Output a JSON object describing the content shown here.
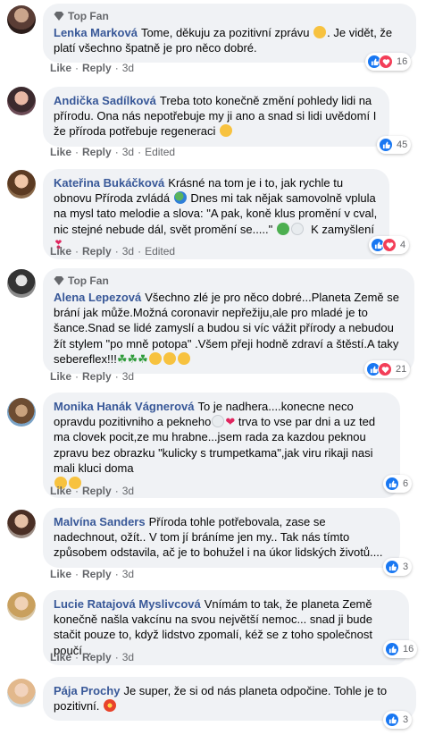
{
  "colors": {
    "author_link": "#385898",
    "meta_text": "#65676b",
    "bubble_bg": "#f0f2f5",
    "like": "#1877f2",
    "love": "#f33e58"
  },
  "actions": {
    "like": "Like",
    "reply": "Reply",
    "edited": "Edited"
  },
  "badges": {
    "top_fan": "Top Fan"
  },
  "comments": [
    {
      "author": "Lenka Marková",
      "top_fan": true,
      "text": "Tome, děkuju za pozitivní zprávu",
      "text2": ". Je vidět, že platí všechno špatně je pro něco dobré.",
      "time": "3d",
      "reactions": [
        "like",
        "love"
      ],
      "count": "16"
    },
    {
      "author": "Andička Sadílková",
      "top_fan": false,
      "text": "Treba toto konečně změní pohledy lidi na přírodu. Ona nás nepotřebuje my ji ano a snad si lidi uvědomí I že příroda potřebuje regeneraci",
      "time": "3d",
      "edited": true,
      "reactions": [
        "like"
      ],
      "count": "45"
    },
    {
      "author": "Kateřina Bukáčková",
      "top_fan": false,
      "text": "Krásné na tom je i to, jak rychle tu obnovu Příroda zvládá",
      "text2": "Dnes mi tak nějak samovolně vplula na mysl tato melodie a slova: \"A pak, koně klus promění v cval,",
      "text3": "nic stejné nebude dál, svět promění se.....\"",
      "text4": "K zamyšlení",
      "time": "3d",
      "edited": true,
      "reactions": [
        "like",
        "love"
      ],
      "count": "4"
    },
    {
      "author": "Alena Lepezová",
      "top_fan": true,
      "text": "Všechno zlé je pro něco dobré...Planeta Země se brání jak může.Možná coronavir nepřežiju,ale pro mladé je to šance.Snad se lidé zamyslí a budou si víc vážit přírody a nebudou žít stylem \"po mně potopa\" .Všem přeji hodně zdraví a štěstí.A taky sebereflex!!!",
      "time": "3d",
      "reactions": [
        "like",
        "love"
      ],
      "count": "21"
    },
    {
      "author": "Monika Hanák Vágnerová",
      "top_fan": false,
      "text": "To je nadhera....konecne neco opravdu pozitivniho a pekneho",
      "text2": "trva to vse par dni a uz ted ma clovek pocit,ze mu hrabne...jsem rada za kazdou peknou zpravu bez obrazku \"kulicky s trumpetkama\",jak viru rikaji nasi mali kluci doma",
      "time": "3d",
      "reactions": [
        "like"
      ],
      "count": "6"
    },
    {
      "author": "Malvína Sanders",
      "top_fan": false,
      "text": "Příroda tohle potřebovala, zase se nadechnout, ožít.. V tom jí bráníme jen my.. Tak nás tímto způsobem odstavila, ač je to bohužel i na úkor lidských životů....",
      "time": "3d",
      "reactions": [
        "like"
      ],
      "count": "3"
    },
    {
      "author": "Lucie Ratajová Myslivcová",
      "top_fan": false,
      "text": "Vnímám to tak, že planeta Země konečně našla vakcínu na svou největší nemoc... snad ji bude stačit pouze to, když lidstvo zpomalí, kéž se z toho společnost poučí...",
      "time": "3d",
      "reactions": [
        "like"
      ],
      "count": "16"
    },
    {
      "author": "Pája Prochy",
      "top_fan": false,
      "text": "Je super, že si od nás planeta odpočine. Tohle je to pozitivní.",
      "time": "3d",
      "reactions": [
        "like"
      ],
      "count": "3"
    }
  ]
}
